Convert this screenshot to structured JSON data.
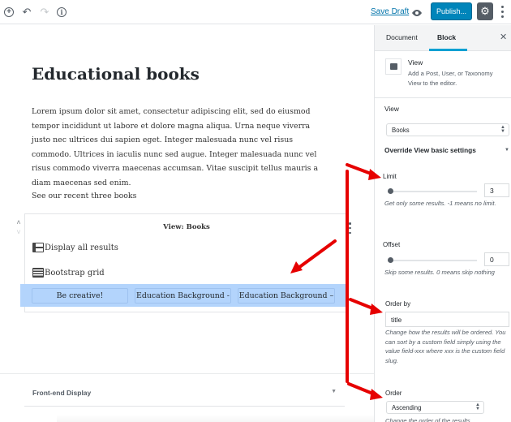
{
  "toolbar": {
    "add_block_icon": "plus-circle-icon",
    "undo_icon": "undo-icon",
    "redo_icon": "redo-icon",
    "info_icon": "info-icon",
    "save_draft": "Save Draft",
    "preview_icon": "eye-icon",
    "publish": "Publish...",
    "settings_icon": "gear-icon",
    "more_icon": "more-vertical-icon"
  },
  "editor": {
    "title": "Educational books",
    "paragraph": "Lorem ipsum dolor sit amet, consectetur adipiscing elit, sed do eiusmod tempor incididunt ut labore et dolore magna aliqua. Urna neque viverra justo nec ultrices dui sapien eget. Integer malesuada nunc vel risus commodo. Ultrices in iaculis nunc sed augue. Integer malesuada nunc vel risus commodo viverra maecenas accumsan. Vitae suscipit tellus mauris a diam maecenas sed enim.",
    "paragraph2": "See our recent three books",
    "view_block": {
      "title": "View: Books",
      "options": [
        "Display all results",
        "Bootstrap grid"
      ],
      "selected_cells": [
        "Be creative!",
        "Education Background -",
        "Education Background –"
      ]
    },
    "meta_panel": {
      "label": "Front-end Display"
    }
  },
  "sidebar": {
    "tabs": [
      "Document",
      "Block"
    ],
    "active_tab": "Block",
    "block": {
      "name": "View",
      "description": "Add a Post, User, or Taxonomy View to the editor."
    },
    "view_label": "View",
    "view_select": "Books",
    "override_label": "Override View basic settings",
    "limit": {
      "label": "Limit",
      "value": "3",
      "help": "Get only some results. -1 means no limit."
    },
    "offset": {
      "label": "Offset",
      "value": "0",
      "help": "Skip some results. 0 means skip nothing"
    },
    "order_by": {
      "label": "Order by",
      "value": "title",
      "help": "Change how the results will be ordered. You can sort by a custom field simply using the value field-xxx where xxx is the custom field slug."
    },
    "order": {
      "label": "Order",
      "value": "Ascending",
      "help": "Change the order of the results"
    }
  },
  "colors": {
    "accent": "#0085ba",
    "tab_underline": "#00a0d2",
    "selection": "#b3d4fc",
    "annotation": "#e60000"
  }
}
